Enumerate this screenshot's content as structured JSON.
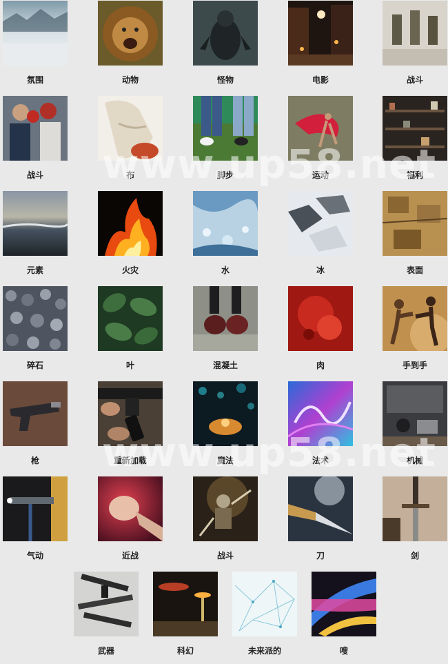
{
  "watermarks": [
    "www.up58.net",
    "www.up58.net"
  ],
  "tiles": [
    {
      "label": "氛围"
    },
    {
      "label": "动物"
    },
    {
      "label": "怪物"
    },
    {
      "label": "电影"
    },
    {
      "label": "战斗"
    },
    {
      "label": "战斗"
    },
    {
      "label": "布"
    },
    {
      "label": "脚步"
    },
    {
      "label": "运动"
    },
    {
      "label": "福利"
    },
    {
      "label": "元素"
    },
    {
      "label": "火灾"
    },
    {
      "label": "水"
    },
    {
      "label": "冰"
    },
    {
      "label": "表面"
    },
    {
      "label": "碎石"
    },
    {
      "label": "叶"
    },
    {
      "label": "混凝土"
    },
    {
      "label": "肉"
    },
    {
      "label": "手到手"
    },
    {
      "label": "枪"
    },
    {
      "label": "重新加载"
    },
    {
      "label": "魔法"
    },
    {
      "label": "法术"
    },
    {
      "label": "机械"
    },
    {
      "label": "气动"
    },
    {
      "label": "近战"
    },
    {
      "label": "战斗"
    },
    {
      "label": "刀"
    },
    {
      "label": "剑"
    },
    {
      "label": "武器"
    },
    {
      "label": "科幻"
    },
    {
      "label": "未来派的"
    },
    {
      "label": "嗖"
    }
  ]
}
